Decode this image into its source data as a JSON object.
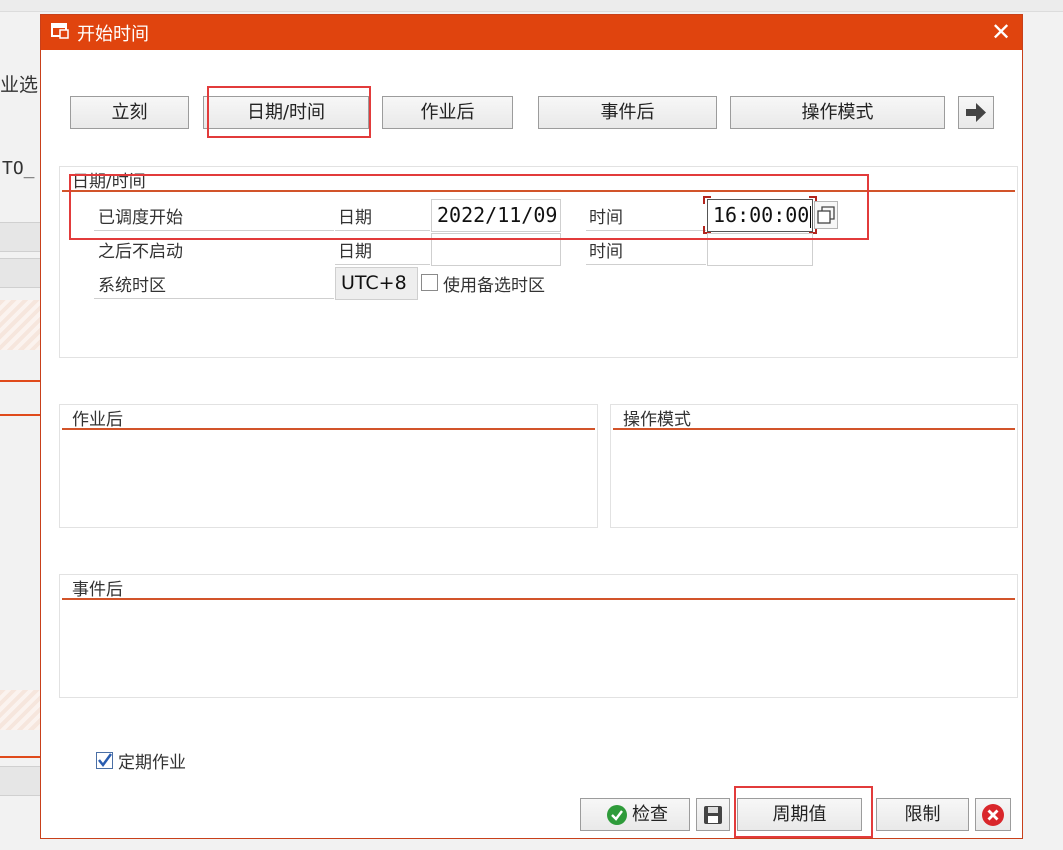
{
  "background": {
    "fragment_left_1": "业选",
    "fragment_left_2": "TO_"
  },
  "dialog": {
    "title": "开始时间",
    "close_glyph": "✕"
  },
  "toolbar": {
    "immediate": "立刻",
    "date_time": "日期/时间",
    "after_job": "作业后",
    "after_event": "事件后",
    "operation_mode": "操作模式"
  },
  "date_time_group": {
    "title": "日期/时间",
    "scheduled_start": {
      "label": "已调度开始",
      "date_label": "日期",
      "date_value": "2022/11/09",
      "time_label": "时间",
      "time_value": "16:00:00"
    },
    "no_start_after": {
      "label": "之后不启动",
      "date_label": "日期",
      "date_value": "",
      "time_label": "时间",
      "time_value": ""
    },
    "timezone": {
      "label": "系统时区",
      "value": "UTC+8",
      "alt_tz_label": "使用备选时区",
      "alt_tz_checked": false
    }
  },
  "after_job_group": {
    "title": "作业后"
  },
  "operation_mode_group": {
    "title": "操作模式"
  },
  "after_event_group": {
    "title": "事件后"
  },
  "periodic_job": {
    "label": "定期作业",
    "checked": true
  },
  "footer": {
    "check": "检查",
    "period_values": "周期值",
    "restrictions": "限制"
  },
  "colors": {
    "title_bar": "#e0440e",
    "accent_rule": "#d2542a",
    "highlight": "#e23b3b",
    "check_green": "#2e9b3a",
    "cancel_red": "#d9262b"
  }
}
